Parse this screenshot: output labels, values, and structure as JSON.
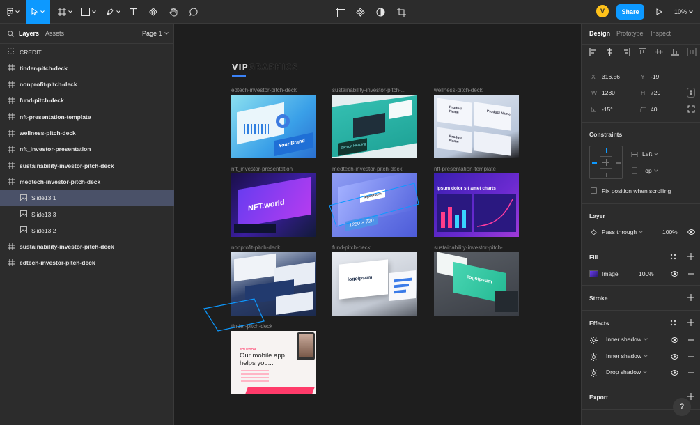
{
  "toolbar": {
    "share_label": "Share",
    "avatar_initial": "V",
    "zoom": "10%"
  },
  "left_panel": {
    "tabs": [
      "Layers",
      "Assets"
    ],
    "page": "Page 1",
    "layers": [
      {
        "label": "CREDIT",
        "type": "grid",
        "child": false,
        "selected": false
      },
      {
        "label": "tinder-pitch-deck",
        "type": "frame",
        "child": false,
        "selected": false
      },
      {
        "label": "nonprofit-pitch-deck",
        "type": "frame",
        "child": false,
        "selected": false
      },
      {
        "label": "fund-pitch-deck",
        "type": "frame",
        "child": false,
        "selected": false
      },
      {
        "label": "nft-presentation-template",
        "type": "frame",
        "child": false,
        "selected": false
      },
      {
        "label": "wellness-pitch-deck",
        "type": "frame",
        "child": false,
        "selected": false
      },
      {
        "label": "nft_investor-presentation",
        "type": "frame",
        "child": false,
        "selected": false
      },
      {
        "label": "sustainability-investor-pitch-deck",
        "type": "frame",
        "child": false,
        "selected": false
      },
      {
        "label": "medtech-investor-pitch-deck",
        "type": "frame",
        "child": false,
        "selected": false
      },
      {
        "label": "Slide13 1",
        "type": "image",
        "child": true,
        "selected": true
      },
      {
        "label": "Slide13 3",
        "type": "image",
        "child": true,
        "selected": false
      },
      {
        "label": "Slide13 2",
        "type": "image",
        "child": true,
        "selected": false
      },
      {
        "label": "sustainability-investor-pitch-deck",
        "type": "frame",
        "child": false,
        "selected": false
      },
      {
        "label": "edtech-investor-pitch-deck",
        "type": "frame",
        "child": false,
        "selected": false
      }
    ]
  },
  "canvas": {
    "logo": {
      "part1": "VIP",
      "part2": "GRAPHICS"
    },
    "frames": [
      {
        "title": "edtech-investor-pitch-deck",
        "text": "Your Brand"
      },
      {
        "title": "sustainability-investor-pitch-...",
        "text": "Section Heading"
      },
      {
        "title": "wellness-pitch-deck",
        "text": "Product Name"
      },
      {
        "title": "nft_investor-presentation",
        "text": "NFT.world"
      },
      {
        "title": "medtech-investor-pitch-deck",
        "text": "1280 × 720"
      },
      {
        "title": "nft-presentation-template",
        "text": "ipsum dolor sit amet charts"
      },
      {
        "title": "nonprofit-pitch-deck",
        "text": ""
      },
      {
        "title": "fund-pitch-deck",
        "text": "logoipsum"
      },
      {
        "title": "sustainability-investor-pitch-...",
        "text": "logoipsum"
      },
      {
        "title": "tinder-pitch-deck",
        "text": "Our mobile app helps you..."
      }
    ],
    "tinder_small": "SOLUTION"
  },
  "right_panel": {
    "tabs": [
      "Design",
      "Prototype",
      "Inspect"
    ],
    "x": "316.56",
    "y": "-19",
    "w": "1280",
    "h": "720",
    "rotation": "-15°",
    "radius": "40",
    "constraints_title": "Constraints",
    "constraint_h": "Left",
    "constraint_v": "Top",
    "fix_position": "Fix position when scrolling",
    "layer_title": "Layer",
    "blend": "Pass through",
    "opacity": "100%",
    "fill_title": "Fill",
    "fill_type": "Image",
    "fill_opacity": "100%",
    "stroke_title": "Stroke",
    "effects_title": "Effects",
    "effects": [
      "Inner shadow",
      "Inner shadow",
      "Drop shadow"
    ],
    "export_title": "Export",
    "help": "?"
  }
}
